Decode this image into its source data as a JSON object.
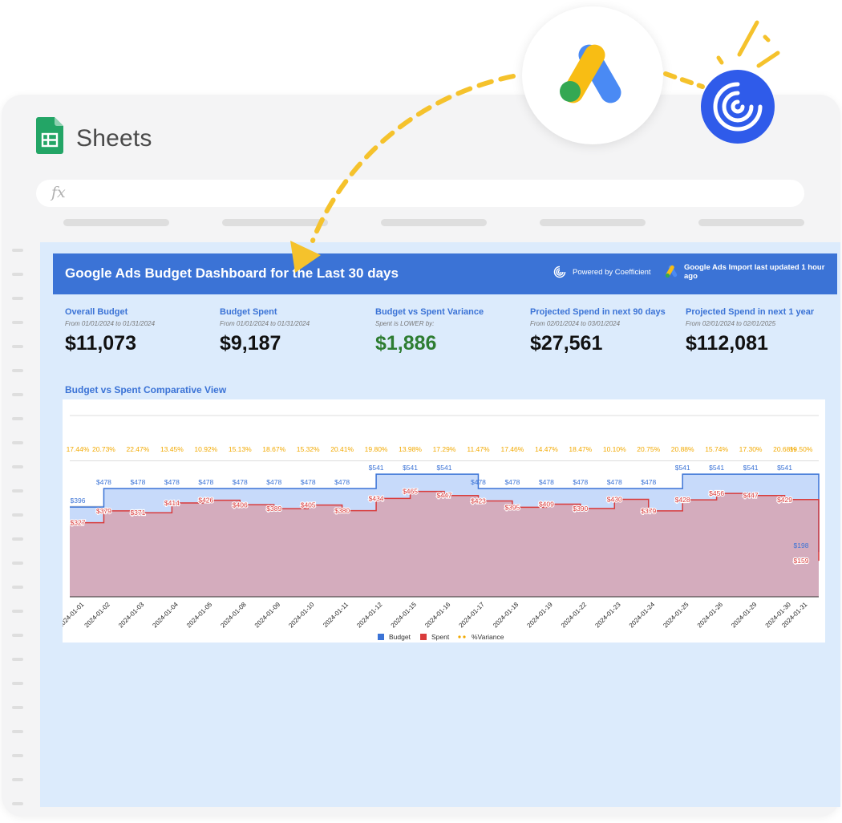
{
  "app": {
    "title": "Sheets",
    "formula_placeholder": "fx"
  },
  "dashboard": {
    "title": "Google Ads Budget Dashboard for the Last 30 days",
    "powered_by": "Powered by Coefficient",
    "last_updated": "Google Ads Import last updated 1 hour ago"
  },
  "kpis": [
    {
      "label": "Overall Budget",
      "sub": "From 01/01/2024 to 01/31/2024",
      "value": "$11,073",
      "color": "#111111"
    },
    {
      "label": "Budget Spent",
      "sub": "From 01/01/2024 to 01/31/2024",
      "value": "$9,187",
      "color": "#111111"
    },
    {
      "label": "Budget vs Spent Variance",
      "sub": "Spent is LOWER by:",
      "value": "$1,886",
      "color": "#2e7d32"
    },
    {
      "label": "Projected Spend in next 90 days",
      "sub": "From 02/01/2024 to 03/01/2024",
      "value": "$27,561",
      "color": "#111111"
    },
    {
      "label": "Projected Spend in next 1 year",
      "sub": "From 02/01/2024 to 02/01/2025",
      "value": "$112,081",
      "color": "#111111"
    }
  ],
  "chart_title": "Budget vs Spent Comparative View",
  "colors": {
    "accent": "#3b73d6",
    "budget": "#3b73d6",
    "spent": "#d93b3b",
    "variance": "#f2a900",
    "positive": "#2e7d32"
  },
  "chart_data": {
    "type": "area",
    "categories": [
      "2024-01-01",
      "2024-01-02",
      "2024-01-03",
      "2024-01-04",
      "2024-01-05",
      "2024-01-08",
      "2024-01-09",
      "2024-01-10",
      "2024-01-11",
      "2024-01-12",
      "2024-01-15",
      "2024-01-16",
      "2024-01-17",
      "2024-01-18",
      "2024-01-19",
      "2024-01-22",
      "2024-01-23",
      "2024-01-24",
      "2024-01-25",
      "2024-01-26",
      "2024-01-29",
      "2024-01-30",
      "2024-01-31"
    ],
    "series": [
      {
        "name": "Budget",
        "values": [
          396,
          478,
          478,
          478,
          478,
          478,
          478,
          478,
          478,
          541,
          541,
          541,
          478,
          478,
          478,
          478,
          478,
          478,
          541,
          541,
          541,
          541,
          198
        ]
      },
      {
        "name": "Spent",
        "values": [
          327,
          379,
          371,
          414,
          426,
          406,
          389,
          405,
          380,
          434,
          465,
          447,
          423,
          395,
          409,
          390,
          430,
          379,
          428,
          456,
          447,
          429,
          159
        ]
      },
      {
        "name": "%Variance",
        "values": [
          "17.44%",
          "20.73%",
          "22.47%",
          "13.45%",
          "10.92%",
          "15.13%",
          "18.67%",
          "15.32%",
          "20.41%",
          "19.80%",
          "13.98%",
          "17.29%",
          "11.47%",
          "17.46%",
          "14.47%",
          "18.47%",
          "10.10%",
          "20.75%",
          "20.88%",
          "15.74%",
          "17.30%",
          "20.68%",
          "19.50%"
        ]
      }
    ],
    "value_labels": {
      "budget": [
        "$396",
        "$478",
        "$478",
        "$478",
        "$478",
        "$478",
        "$478",
        "$478",
        "$478",
        "$541",
        "$541",
        "$541",
        "$478",
        "$478",
        "$478",
        "$478",
        "$478",
        "$478",
        "$541",
        "$541",
        "$541",
        "$541",
        "$198"
      ],
      "spent": [
        "$327",
        "$379",
        "$371",
        "$414",
        "$426",
        "$406",
        "$389",
        "$405",
        "$380",
        "$434",
        "$465",
        "$447",
        "$423",
        "$395",
        "$409",
        "$390",
        "$430",
        "$379",
        "$428",
        "$456",
        "$447",
        "$429",
        "$159"
      ]
    },
    "legend": [
      "Budget",
      "Spent",
      "%Variance"
    ],
    "legend_position": "bottom",
    "ylim": [
      0,
      800
    ],
    "grid": true
  }
}
